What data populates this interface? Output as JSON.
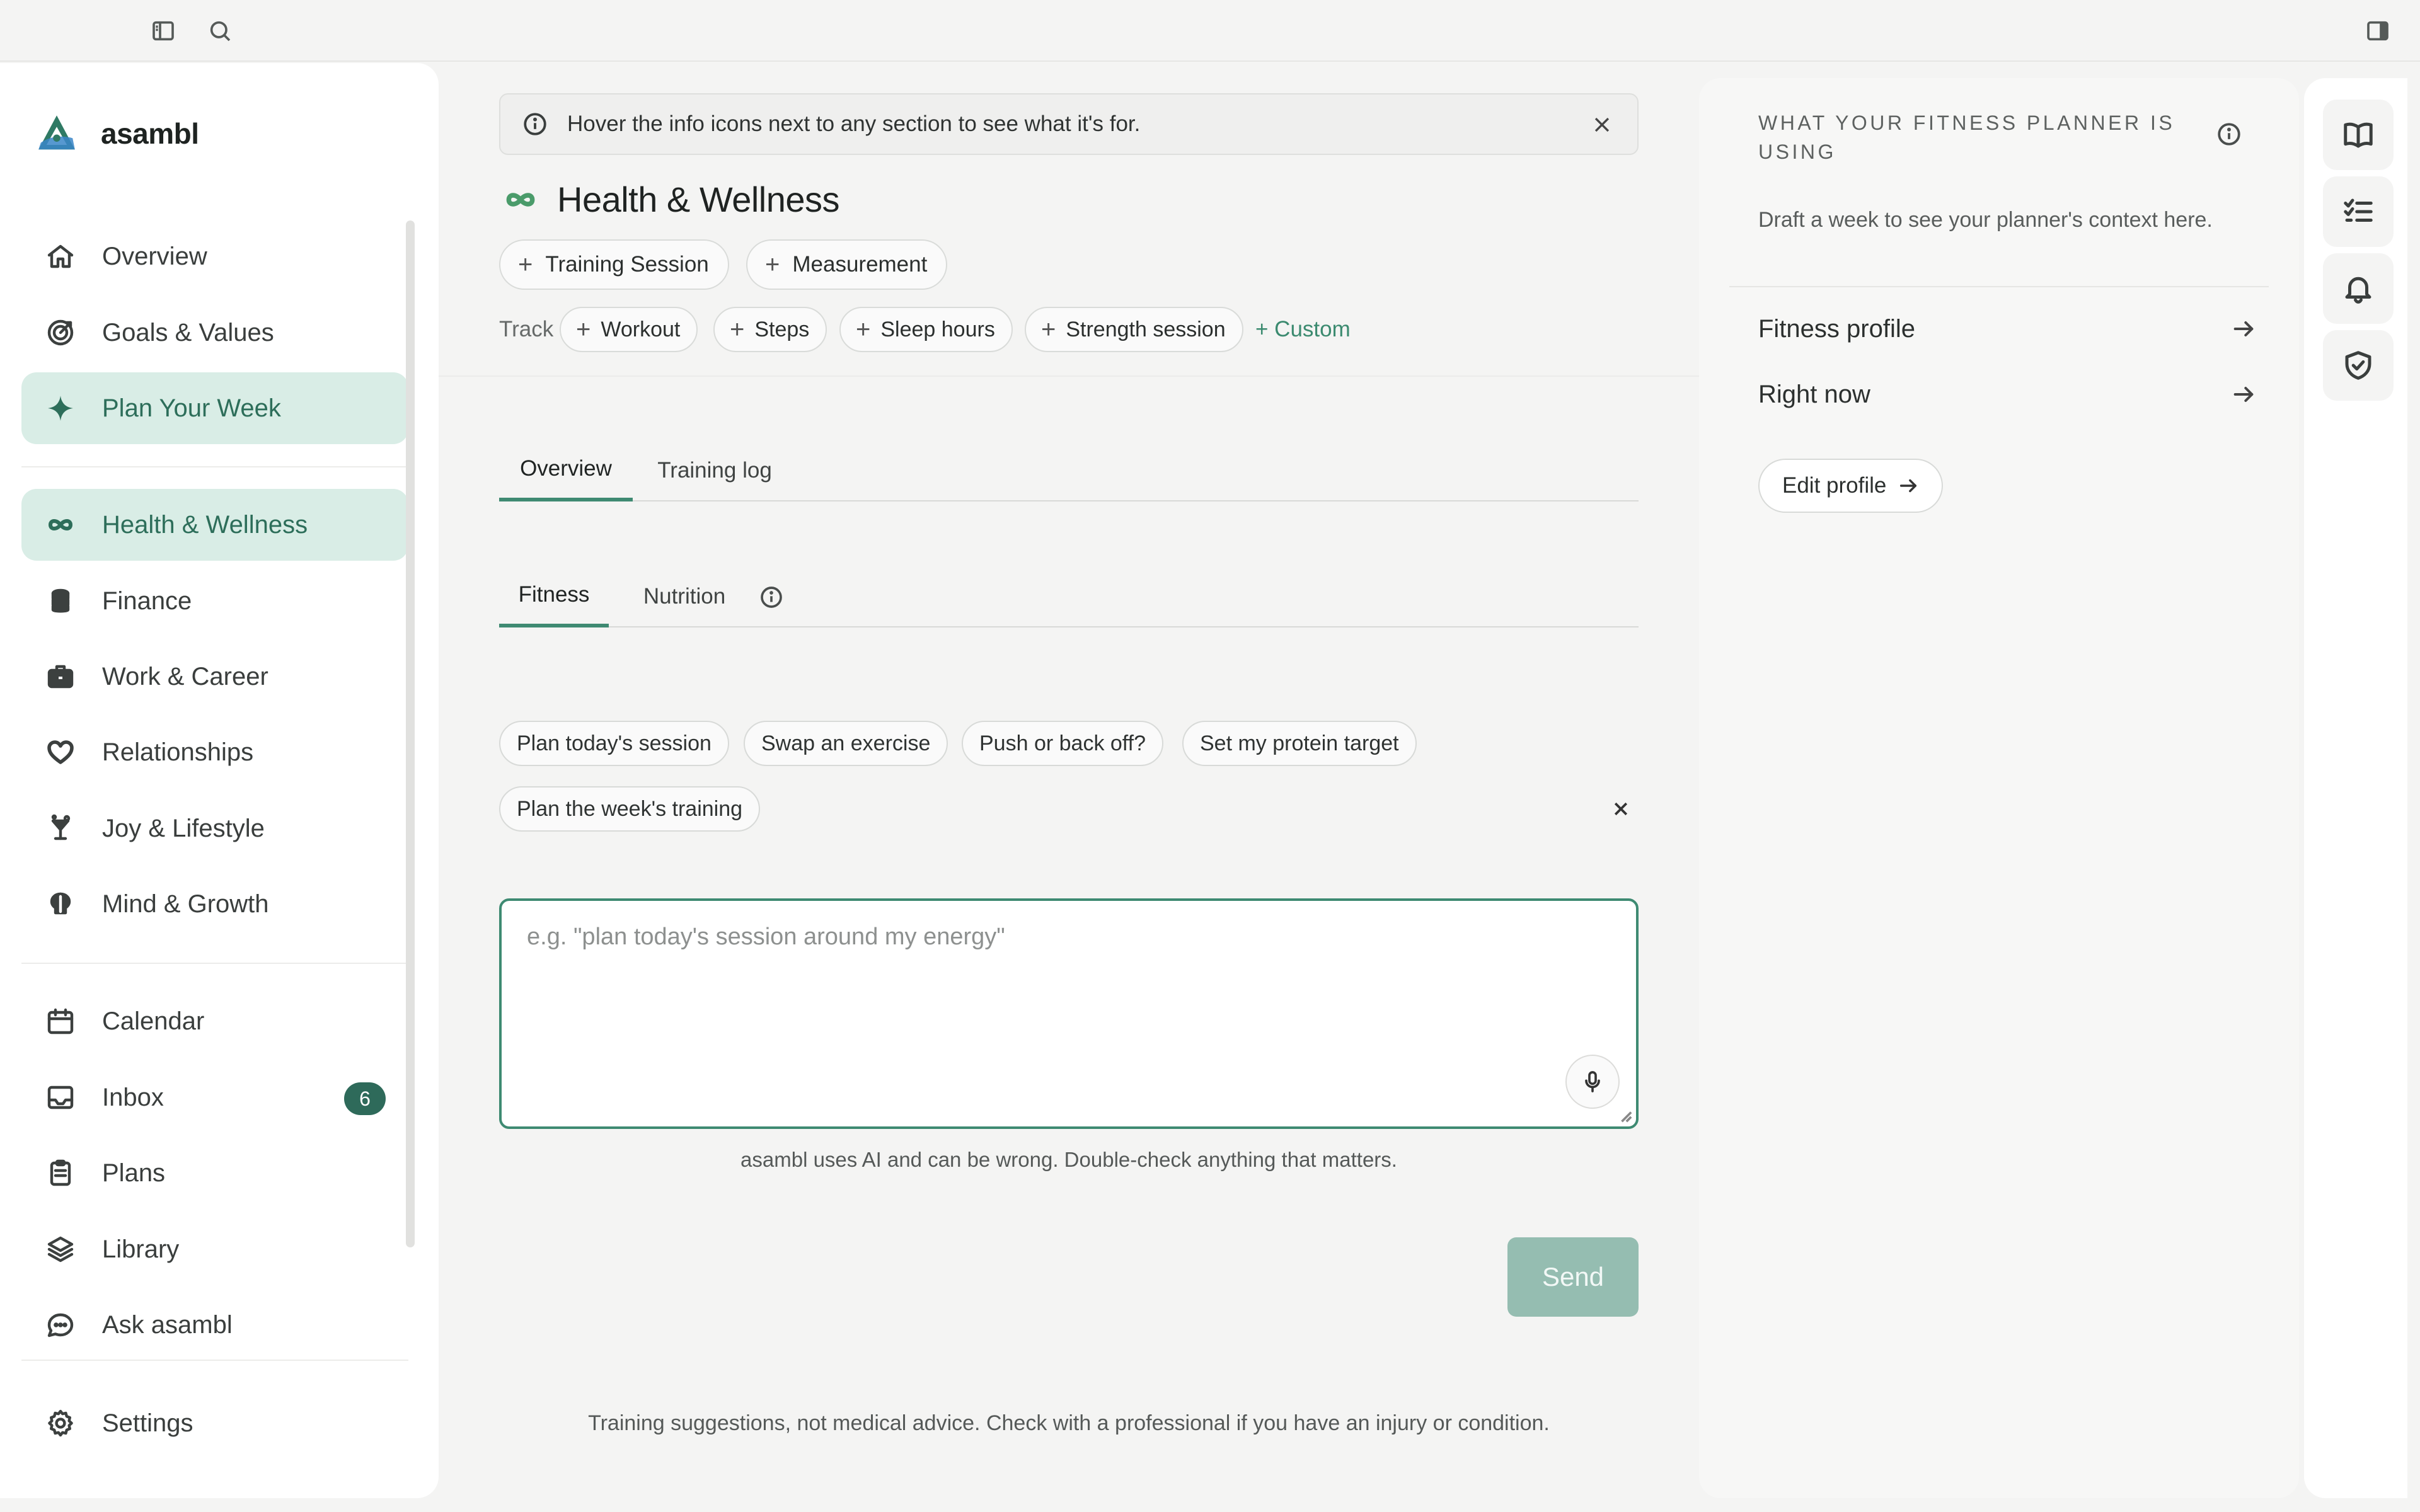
{
  "brand": {
    "name": "asambl"
  },
  "sidebar": {
    "primary": [
      {
        "label": "Overview",
        "icon": "home-icon",
        "active": false
      },
      {
        "label": "Goals & Values",
        "icon": "target-icon",
        "active": false
      },
      {
        "label": "Plan Your Week",
        "icon": "sparkle-icon",
        "active": true
      }
    ],
    "areas": [
      {
        "label": "Health & Wellness",
        "icon": "infinity-icon",
        "active": true
      },
      {
        "label": "Finance",
        "icon": "coins-icon",
        "active": false
      },
      {
        "label": "Work & Career",
        "icon": "briefcase-icon",
        "active": false
      },
      {
        "label": "Relationships",
        "icon": "heart-icon",
        "active": false
      },
      {
        "label": "Joy & Lifestyle",
        "icon": "cocktail-icon",
        "active": false
      },
      {
        "label": "Mind & Growth",
        "icon": "brain-icon",
        "active": false
      }
    ],
    "tools": [
      {
        "label": "Calendar",
        "icon": "calendar-icon"
      },
      {
        "label": "Inbox",
        "icon": "inbox-icon",
        "badge": "6"
      },
      {
        "label": "Plans",
        "icon": "clipboard-icon"
      },
      {
        "label": "Library",
        "icon": "layers-icon"
      },
      {
        "label": "Ask asambl",
        "icon": "chat-bubble-icon"
      }
    ],
    "settings": {
      "label": "Settings",
      "icon": "gear-icon"
    }
  },
  "banner": {
    "text": "Hover the info icons next to any section to see what it's for."
  },
  "page": {
    "title": "Health & Wellness",
    "actions": [
      "Training Session",
      "Measurement"
    ],
    "track_label": "Track",
    "track_items": [
      "Workout",
      "Steps",
      "Sleep hours",
      "Strength session"
    ],
    "custom_label": "+ Custom"
  },
  "tabs": {
    "items": [
      "Overview",
      "Training log"
    ],
    "active": "Overview"
  },
  "subtabs": {
    "items": [
      "Fitness",
      "Nutrition"
    ],
    "active": "Fitness"
  },
  "suggestions": [
    "Plan today's session",
    "Swap an exercise",
    "Push or back off?",
    "Set my protein target",
    "Plan the week's training"
  ],
  "composer": {
    "placeholder": "e.g. \"plan today's session around my energy\"",
    "value": "",
    "ai_disclaimer": "asambl uses AI and can be wrong. Double-check anything that matters.",
    "send_label": "Send"
  },
  "medical_disclaimer": "Training suggestions, not medical advice. Check with a professional if you have an injury or condition.",
  "context_panel": {
    "title": "What your fitness planner is using",
    "note": "Draft a week to see your planner's context here.",
    "rows": [
      "Fitness profile",
      "Right now"
    ],
    "edit_label": "Edit profile"
  },
  "colors": {
    "accent": "#3e8a72",
    "accent_soft": "#d9ede6",
    "badge": "#2e6a5a",
    "send_disabled": "#95bdb1"
  }
}
